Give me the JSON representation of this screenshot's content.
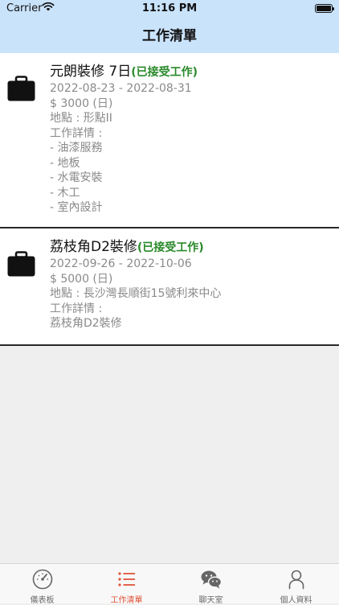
{
  "status_bar": {
    "carrier": "Carrier",
    "time": "11:16 PM"
  },
  "nav": {
    "title": "工作清單"
  },
  "jobs": [
    {
      "title": "元朗裝修 7日",
      "status": "(已接受工作)",
      "dates": "2022-08-23 - 2022-08-31",
      "price": "$ 3000 (日)",
      "location": "地點 : 形點II",
      "details_label": "工作詳情 :",
      "details": [
        " - 油漆服務",
        "- 地板",
        "- 水電安裝",
        "- 木工",
        "- 室內設計"
      ],
      "icon": "briefcase-icon"
    },
    {
      "title": "荔枝角D2裝修",
      "status": "(已接受工作)",
      "dates": "2022-09-26 - 2022-10-06",
      "price": "$ 5000 (日)",
      "location": "地點 : 長沙灣長順街15號利來中心",
      "details_label": "工作詳情 :",
      "details": [
        " 荔枝角D2裝修"
      ],
      "icon": "briefcase-icon"
    }
  ],
  "tabs": [
    {
      "label": "儀表板",
      "icon": "speedometer-icon"
    },
    {
      "label": "工作清單",
      "icon": "list-icon",
      "active": true
    },
    {
      "label": "聊天室",
      "icon": "wechat-icon"
    },
    {
      "label": "個人資料",
      "icon": "person-icon"
    }
  ],
  "colors": {
    "header_bg": "#c9e3fb",
    "status_green": "#2a8a2a",
    "active_tab": "#e0533a",
    "background": "#efeff0"
  }
}
